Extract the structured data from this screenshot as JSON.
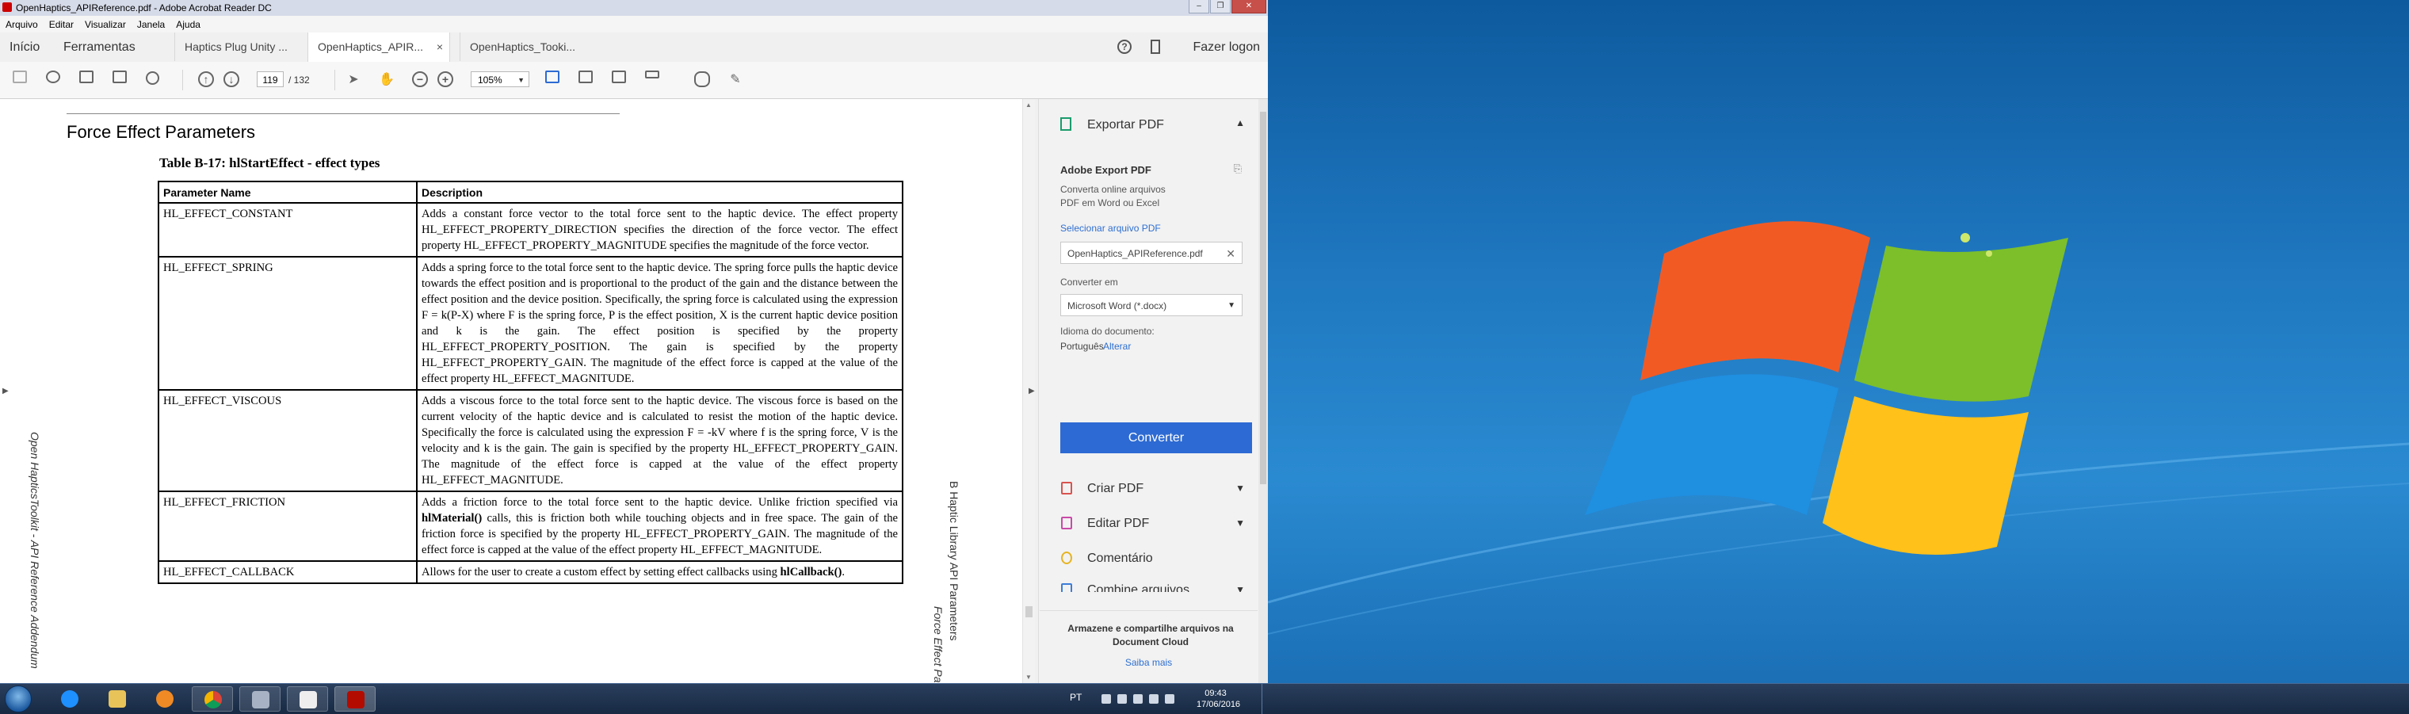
{
  "window": {
    "title": "OpenHaptics_APIReference.pdf - Adobe Acrobat Reader DC",
    "controls": [
      "–",
      "❐",
      "✕"
    ]
  },
  "menu": [
    "Arquivo",
    "Editar",
    "Visualizar",
    "Janela",
    "Ajuda"
  ],
  "nav": {
    "home": "Início",
    "tools": "Ferramentas",
    "logon": "Fazer logon",
    "help_icon": "?"
  },
  "tabs": [
    {
      "label": "Haptics Plug Unity ..."
    },
    {
      "label": "OpenHaptics_APIR...",
      "close": "×"
    },
    {
      "label": "OpenHaptics_Tooki..."
    }
  ],
  "toolbar": {
    "page_current": "119",
    "page_total": "/ 132",
    "zoom": "105%"
  },
  "document": {
    "section_title": "Force Effect Parameters",
    "table_title": "Table B-17: hlStartEffect - effect types",
    "headers": [
      "Parameter Name",
      "Description"
    ],
    "rows": [
      {
        "name": "HL_EFFECT_CONSTANT",
        "desc": "Adds a constant force vector to the total force sent to the haptic device. The effect property HL_EFFECT_PROPERTY_DIRECTION specifies the direction of the force vector. The effect property HL_EFFECT_PROPERTY_MAGNITUDE specifies the magnitude of the force vector."
      },
      {
        "name": "HL_EFFECT_SPRING",
        "desc": "Adds a spring force to the total force sent to the haptic device. The spring force pulls the haptic device towards the effect position and is proportional to the product of the gain and the distance between the effect position and the device position. Specifically, the spring force is calculated using the expression F = k(P-X) where F is the spring force, P is the effect position, X is the current haptic device position and k is the gain. The effect position is specified by the property HL_EFFECT_PROPERTY_POSITION. The gain is specified by the property HL_EFFECT_PROPERTY_GAIN. The magnitude of the effect force is capped at the value of the effect property HL_EFFECT_MAGNITUDE."
      },
      {
        "name": "HL_EFFECT_VISCOUS",
        "desc": "Adds a viscous force to the total force sent to the haptic device. The viscous force is based on the current velocity of the haptic device and is calculated to resist the motion of the haptic device. Specifically the force is calculated using the expression F = -kV where f is the spring force, V is the velocity and k is the gain. The gain is specified by the property HL_EFFECT_PROPERTY_GAIN. The magnitude of the effect force is capped at the value of the effect property HL_EFFECT_MAGNITUDE."
      },
      {
        "name": "HL_EFFECT_FRICTION",
        "desc_pre": "Adds a friction force to the total force sent to the haptic device. Unlike friction specified via ",
        "desc_bold": "hlMaterial()",
        "desc_post": " calls, this is friction both while touching objects and in free space. The gain of the friction force is specified by the property HL_EFFECT_PROPERTY_GAIN. The magnitude of the effect force is capped at the value of the effect property HL_EFFECT_MAGNITUDE."
      },
      {
        "name": "HL_EFFECT_CALLBACK",
        "desc_pre": "Allows for the user to create a custom effect by setting effect callbacks using ",
        "desc_bold": "hlCallback()",
        "desc_post": "."
      }
    ],
    "side_left": "Open HapticsToolkit - API Reference Addendum",
    "side_right_1": "B Haptic Library API Parameters",
    "side_right_2": "Force Effect Pa"
  },
  "pane": {
    "export_title": "Exportar PDF",
    "adobe_export": "Adobe Export PDF",
    "description": "Converta online arquivos PDF em Word ou Excel",
    "select_file": "Selecionar arquivo PDF",
    "file_name": "OpenHaptics_APIReference.pdf",
    "convert_to_label": "Converter em",
    "format": "Microsoft Word (*.docx)",
    "lang_label": "Idioma do documento:",
    "lang_value": "Português",
    "lang_change": "Alterar",
    "convert_button": "Converter",
    "tools": [
      {
        "label": "Criar PDF",
        "color": "#d9534f"
      },
      {
        "label": "Editar PDF",
        "color": "#c94aa8"
      },
      {
        "label": "Comentário",
        "color": "#e6b422"
      },
      {
        "label": "Combine arquivos",
        "color": "#3b7dd8"
      }
    ],
    "cloud_text": "Armazene e compartilhe arquivos na Document Cloud",
    "cloud_link": "Saiba mais"
  },
  "taskbar": {
    "lang": "PT",
    "time": "09:43",
    "date": "17/06/2016"
  },
  "colors": {
    "accent_blue": "#2d6ad3",
    "export_green": "#1a9c6d",
    "link_blue": "#2e6fd1"
  }
}
